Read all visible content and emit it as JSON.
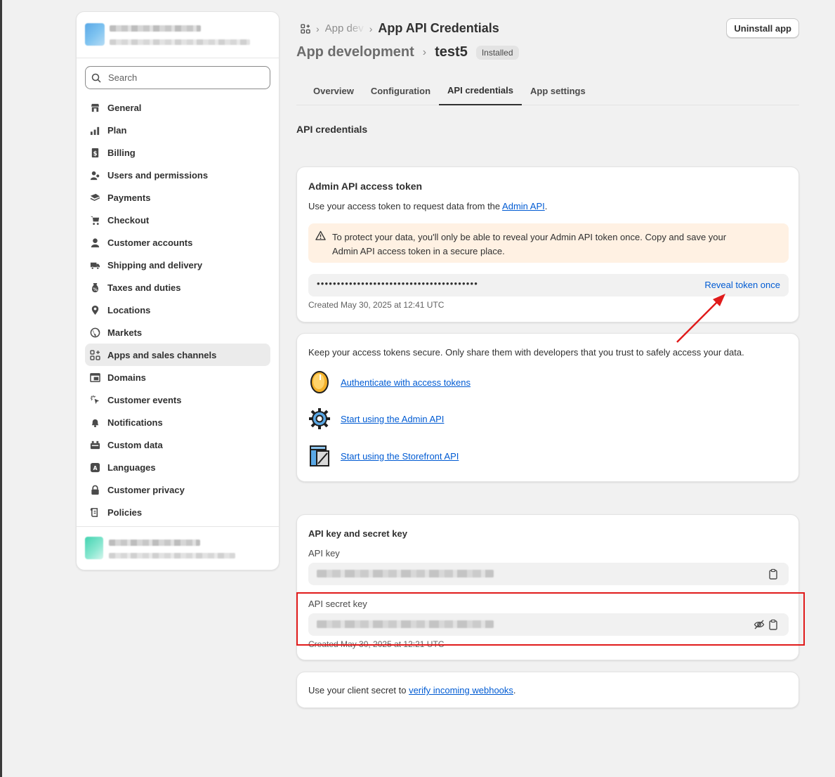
{
  "sidebar": {
    "search_placeholder": "Search",
    "items": [
      {
        "label": "General",
        "icon": "store-icon"
      },
      {
        "label": "Plan",
        "icon": "chart-icon"
      },
      {
        "label": "Billing",
        "icon": "billing-icon"
      },
      {
        "label": "Users and permissions",
        "icon": "users-icon"
      },
      {
        "label": "Payments",
        "icon": "payments-icon"
      },
      {
        "label": "Checkout",
        "icon": "cart-icon"
      },
      {
        "label": "Customer accounts",
        "icon": "person-icon"
      },
      {
        "label": "Shipping and delivery",
        "icon": "truck-icon"
      },
      {
        "label": "Taxes and duties",
        "icon": "tax-icon"
      },
      {
        "label": "Locations",
        "icon": "location-icon"
      },
      {
        "label": "Markets",
        "icon": "globe-icon"
      },
      {
        "label": "Apps and sales channels",
        "icon": "apps-icon",
        "active": true
      },
      {
        "label": "Domains",
        "icon": "domains-icon"
      },
      {
        "label": "Customer events",
        "icon": "cursor-icon"
      },
      {
        "label": "Notifications",
        "icon": "bell-icon"
      },
      {
        "label": "Custom data",
        "icon": "custom-data-icon"
      },
      {
        "label": "Languages",
        "icon": "language-icon"
      },
      {
        "label": "Customer privacy",
        "icon": "lock-icon"
      },
      {
        "label": "Policies",
        "icon": "policies-icon"
      }
    ]
  },
  "header": {
    "breadcrumb_partial": "App dev",
    "breadcrumb_current": "App API Credentials",
    "uninstall_label": "Uninstall app",
    "title_parent": "App development",
    "title_app": "test5",
    "status_badge": "Installed"
  },
  "tabs": [
    "Overview",
    "Configuration",
    "API credentials",
    "App settings"
  ],
  "active_tab": "API credentials",
  "section_title": "API credentials",
  "admin_token_card": {
    "title": "Admin API access token",
    "desc_prefix": "Use your access token to request data from the ",
    "desc_link": "Admin API",
    "desc_suffix": ".",
    "warning_line1": "To protect your data, you'll only be able to reveal your Admin API token once. Copy and save your",
    "warning_line2": "Admin API access token in a secure place.",
    "masked_token": "••••••••••••••••••••••••••••••••••••••••",
    "reveal_label": "Reveal token once",
    "created": "Created May 30, 2025 at 12:41 UTC"
  },
  "security_card": {
    "intro": "Keep your access tokens secure. Only share them with developers that you trust to safely access your data.",
    "links": [
      {
        "label": "Authenticate with access tokens",
        "icon": "token-coin-icon"
      },
      {
        "label": "Start using the Admin API",
        "icon": "gear-icon"
      },
      {
        "label": "Start using the Storefront API",
        "icon": "storefront-icon"
      }
    ]
  },
  "keys_card": {
    "title": "API key and secret key",
    "api_key_label": "API key",
    "api_secret_label": "API secret key",
    "created": "Created May 30, 2025 at 12:21 UTC"
  },
  "webhook_card": {
    "prefix": "Use your client secret to ",
    "link": "verify incoming webhooks",
    "suffix": "."
  },
  "colors": {
    "link": "#005bd3",
    "warning_bg": "#fff1e3",
    "annotation": "#e01b1b"
  }
}
